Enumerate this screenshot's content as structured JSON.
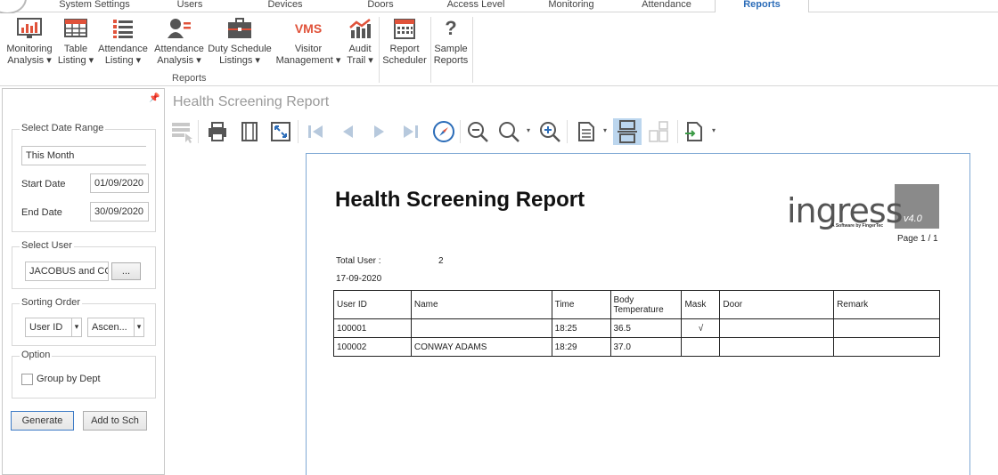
{
  "tabs": [
    {
      "label": "System Settings"
    },
    {
      "label": "Users"
    },
    {
      "label": "Devices"
    },
    {
      "label": "Doors"
    },
    {
      "label": "Access Level"
    },
    {
      "label": "Monitoring"
    },
    {
      "label": "Attendance"
    },
    {
      "label": "Reports"
    }
  ],
  "ribbon": {
    "buttons": [
      {
        "line1": "Monitoring",
        "line2": "Analysis ▾",
        "icon": "monitoring-chart-icon"
      },
      {
        "line1": "Table",
        "line2": "Listing ▾",
        "icon": "table-grid-icon"
      },
      {
        "line1": "Attendance",
        "line2": "Listing ▾",
        "icon": "list-icon"
      },
      {
        "line1": "Attendance",
        "line2": "Analysis ▾",
        "icon": "person-list-icon"
      },
      {
        "line1": "Duty Schedule",
        "line2": "Listings ▾",
        "icon": "briefcase-icon"
      },
      {
        "line1": "Visitor",
        "line2": "Management ▾",
        "icon": "vms-icon",
        "icon_text": "VMS"
      },
      {
        "line1": "Audit",
        "line2": "Trail ▾",
        "icon": "audit-chart-icon"
      },
      {
        "line1": "Report",
        "line2": "Scheduler",
        "icon": "calendar-icon"
      },
      {
        "line1": "Sample",
        "line2": "Reports",
        "icon": "question-icon",
        "icon_text": "?"
      }
    ],
    "group_label": "Reports"
  },
  "panel": {
    "pin_glyph": "📌",
    "date_range": {
      "legend": "Select Date Range",
      "preset": "This Month",
      "start_label": "Start Date",
      "start_value": "01/09/2020",
      "end_label": "End Date",
      "end_value": "30/09/2020"
    },
    "user": {
      "legend": "Select User",
      "value": "JACOBUS and CO",
      "browse": "..."
    },
    "sorting": {
      "legend": "Sorting Order",
      "field": "User ID",
      "direction": "Ascen..."
    },
    "option": {
      "legend": "Option",
      "group_by_dept": "Group by Dept",
      "checked": false
    },
    "generate": "Generate",
    "add_schedule": "Add to Sch"
  },
  "viewer": {
    "title": "Health Screening Report"
  },
  "report": {
    "title": "Health Screening Report",
    "logo_word": "ingress",
    "logo_version": "v4.0",
    "logo_tagline": "A Software by FingerTec",
    "page": "Page 1 / 1",
    "total_user_label": "Total User :",
    "total_user_value": "2",
    "date": "17-09-2020",
    "columns": [
      "User ID",
      "Name",
      "Time",
      "Body Temperature",
      "Mask",
      "Door",
      "Remark"
    ],
    "rows": [
      [
        "100001",
        "",
        "18:25",
        "36.5",
        "√",
        "",
        ""
      ],
      [
        "100002",
        "CONWAY ADAMS",
        "18:29",
        "37.0",
        "",
        "",
        ""
      ]
    ]
  },
  "colors": {
    "accent": "#2b6cb8",
    "ribbon_icon_red": "#e0523a",
    "checked_tool": "#bcd6ee",
    "page_border": "#7fa8d4"
  }
}
